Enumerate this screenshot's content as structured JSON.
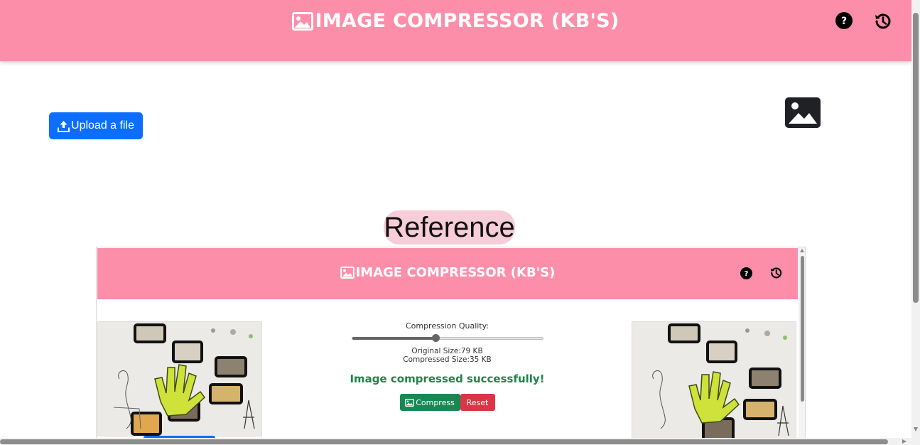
{
  "header": {
    "title": "IMAGE COMPRESSOR (KB'S)",
    "background_color": "#fd8ea9",
    "title_icon": "image-icon",
    "help_icon": "question-circle-icon",
    "history_icon": "history-icon"
  },
  "upload": {
    "label": "Upload a file",
    "icon": "upload-icon",
    "color": "#0d6efd"
  },
  "placeholder_icon": "image-icon",
  "reference": {
    "label": "Reference",
    "header_title": "IMAGE COMPRESSOR (KB'S)",
    "compression_quality_label": "Compression Quality:",
    "quality_value": 0.44,
    "original_size": "Original Size:79 KB",
    "compressed_size": "Compressed Size:35 KB",
    "success_message": "Image compressed successfully!",
    "compress_label": "Compress",
    "reset_label": "Reset",
    "colors": {
      "success": "#198754",
      "danger": "#dc3545"
    }
  }
}
